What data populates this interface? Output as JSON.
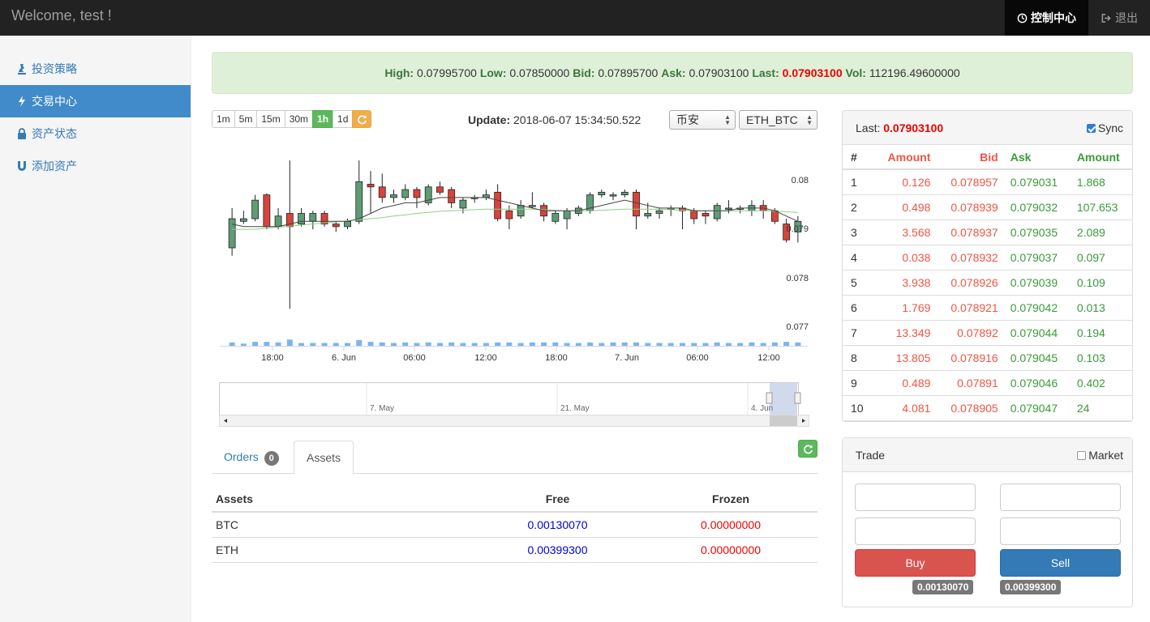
{
  "nav": {
    "brand": "Welcome, test !",
    "control_center": "控制中心",
    "logout": "退出"
  },
  "sidebar": {
    "items": [
      {
        "label": "投资策略",
        "icon": "chess-icon"
      },
      {
        "label": "交易中心",
        "icon": "flash-icon"
      },
      {
        "label": "资产状态",
        "icon": "lock-icon"
      },
      {
        "label": "添加资产",
        "icon": "magnet-icon"
      }
    ]
  },
  "ticker": {
    "high_label": "High:",
    "high": "0.07995700",
    "low_label": "Low:",
    "low": "0.07850000",
    "bid_label": "Bid:",
    "bid": "0.07895700",
    "ask_label": "Ask:",
    "ask": "0.07903100",
    "last_label": "Last:",
    "last": "0.07903100",
    "vol_label": "Vol:",
    "vol": "112196.49600000"
  },
  "intervals": [
    "1m",
    "5m",
    "15m",
    "30m",
    "1h",
    "1d"
  ],
  "active_interval": "1h",
  "update": {
    "label": "Update:",
    "value": "2018-06-07 15:34:50.522"
  },
  "exchange_select": "币安",
  "pair_select": "ETH_BTC",
  "chart_data": {
    "type": "candlestick",
    "y_ticks": [
      "0.08",
      "0.079",
      "0.078",
      "0.077"
    ],
    "ylim": [
      0.0769,
      0.0806
    ],
    "x_ticks": [
      "18:00",
      "6. Jun",
      "06:00",
      "12:00",
      "18:00",
      "7. Jun",
      "06:00",
      "12:00"
    ],
    "navigator_ticks": [
      "7. May",
      "21. May",
      "4. Jun"
    ],
    "candles": [
      [
        0.07875,
        0.0793,
        0.0795,
        0.0786
      ],
      [
        0.07925,
        0.0793,
        0.07945,
        0.0792
      ],
      [
        0.0793,
        0.07965,
        0.07975,
        0.07925
      ],
      [
        0.07975,
        0.07915,
        0.07978,
        0.0791
      ],
      [
        0.07915,
        0.07935,
        0.0795,
        0.0791
      ],
      [
        0.0794,
        0.07915,
        0.0804,
        0.0776
      ],
      [
        0.0792,
        0.0794,
        0.0795,
        0.07915
      ],
      [
        0.07925,
        0.0794,
        0.07945,
        0.0791
      ],
      [
        0.0794,
        0.0792,
        0.07945,
        0.07915
      ],
      [
        0.0792,
        0.07915,
        0.07925,
        0.07905
      ],
      [
        0.07915,
        0.07925,
        0.0793,
        0.0791
      ],
      [
        0.07925,
        0.08,
        0.0804,
        0.0792
      ],
      [
        0.07995,
        0.0799,
        0.0802,
        0.0794
      ],
      [
        0.0799,
        0.0797,
        0.08015,
        0.0796
      ],
      [
        0.0797,
        0.07975,
        0.07985,
        0.0796
      ],
      [
        0.0797,
        0.07985,
        0.07995,
        0.07965
      ],
      [
        0.07985,
        0.0797,
        0.0799,
        0.0795
      ],
      [
        0.0796,
        0.0799,
        0.07995,
        0.07955
      ],
      [
        0.0799,
        0.0798,
        0.08,
        0.07975
      ],
      [
        0.07985,
        0.0796,
        0.0799,
        0.0795
      ],
      [
        0.0795,
        0.07965,
        0.0797,
        0.0794
      ],
      [
        0.0797,
        0.0797,
        0.07975,
        0.0796
      ],
      [
        0.0797,
        0.07975,
        0.07985,
        0.07965
      ],
      [
        0.0798,
        0.0793,
        0.07995,
        0.07925
      ],
      [
        0.07945,
        0.0793,
        0.07955,
        0.0791
      ],
      [
        0.07935,
        0.07955,
        0.07965,
        0.0793
      ],
      [
        0.07955,
        0.07955,
        0.0798,
        0.0795
      ],
      [
        0.07955,
        0.07935,
        0.0796,
        0.07925
      ],
      [
        0.07925,
        0.0794,
        0.07945,
        0.0792
      ],
      [
        0.0793,
        0.07945,
        0.0795,
        0.0791
      ],
      [
        0.0794,
        0.0795,
        0.07955,
        0.07935
      ],
      [
        0.07945,
        0.07975,
        0.0798,
        0.0794
      ],
      [
        0.07975,
        0.0798,
        0.07985,
        0.0797
      ],
      [
        0.07975,
        0.07975,
        0.0798,
        0.07965
      ],
      [
        0.07975,
        0.0798,
        0.07985,
        0.0797
      ],
      [
        0.0798,
        0.07935,
        0.07985,
        0.0791
      ],
      [
        0.07935,
        0.0794,
        0.0796,
        0.0793
      ],
      [
        0.0794,
        0.07945,
        0.0795,
        0.0793
      ],
      [
        0.0795,
        0.0795,
        0.07955,
        0.07935
      ],
      [
        0.0795,
        0.07945,
        0.07955,
        0.0791
      ],
      [
        0.07945,
        0.0793,
        0.0795,
        0.0792
      ],
      [
        0.0794,
        0.07935,
        0.07945,
        0.0792
      ],
      [
        0.0793,
        0.07955,
        0.0796,
        0.07925
      ],
      [
        0.0795,
        0.0795,
        0.07965,
        0.0794
      ],
      [
        0.0795,
        0.0795,
        0.07955,
        0.0794
      ],
      [
        0.07945,
        0.07955,
        0.07965,
        0.07935
      ],
      [
        0.07955,
        0.07945,
        0.07965,
        0.0793
      ],
      [
        0.07945,
        0.07925,
        0.0795,
        0.0792
      ],
      [
        0.0792,
        0.0789,
        0.0793,
        0.07885
      ],
      [
        0.07905,
        0.07925,
        0.07935,
        0.07885
      ]
    ],
    "volumes": [
      0.3,
      0.2,
      0.35,
      0.35,
      0.3,
      0.55,
      0.25,
      0.25,
      0.25,
      0.25,
      0.25,
      0.5,
      0.35,
      0.3,
      0.25,
      0.3,
      0.25,
      0.3,
      0.25,
      0.3,
      0.25,
      0.25,
      0.25,
      0.3,
      0.3,
      0.25,
      0.3,
      0.3,
      0.3,
      0.25,
      0.25,
      0.3,
      0.25,
      0.3,
      0.3,
      0.3,
      0.25,
      0.25,
      0.25,
      0.25,
      0.25,
      0.25,
      0.3,
      0.25,
      0.25,
      0.3,
      0.25,
      0.3,
      0.35,
      0.3
    ],
    "ma_dark": [
      0.0792,
      0.07915,
      0.07915,
      0.07915,
      0.07915,
      0.0792,
      0.07925,
      0.07925,
      0.07925,
      0.07925,
      0.07925,
      0.0793,
      0.0794,
      0.0795,
      0.07955,
      0.0796,
      0.0796,
      0.07965,
      0.0797,
      0.0797,
      0.0797,
      0.0797,
      0.0797,
      0.07965,
      0.0796,
      0.07955,
      0.0795,
      0.07945,
      0.07945,
      0.07945,
      0.07945,
      0.0795,
      0.07955,
      0.0796,
      0.07965,
      0.0796,
      0.07955,
      0.0795,
      0.0795,
      0.0795,
      0.07945,
      0.07945,
      0.07945,
      0.07945,
      0.0795,
      0.0795,
      0.0795,
      0.07945,
      0.07935,
      0.07925
    ],
    "ma_light": [
      0.0791,
      0.0791,
      0.0791,
      0.07912,
      0.07914,
      0.07916,
      0.07918,
      0.0792,
      0.07922,
      0.07924,
      0.07926,
      0.07928,
      0.0793,
      0.07932,
      0.07935,
      0.07937,
      0.0794,
      0.07942,
      0.07944,
      0.07945,
      0.07946,
      0.07947,
      0.07948,
      0.07948,
      0.07948,
      0.07948,
      0.07948,
      0.07947,
      0.07946,
      0.07945,
      0.07945,
      0.07945,
      0.07946,
      0.07947,
      0.07948,
      0.07948,
      0.07948,
      0.07948,
      0.07947,
      0.07946,
      0.07945,
      0.07945,
      0.07945,
      0.07945,
      0.07945,
      0.07945,
      0.07945,
      0.07944,
      0.07943,
      0.07942
    ]
  },
  "tabs": {
    "orders": "Orders",
    "orders_count": "0",
    "assets": "Assets"
  },
  "assets_table": {
    "headers": [
      "Assets",
      "Free",
      "Frozen"
    ],
    "rows": [
      [
        "BTC",
        "0.00130070",
        "0.00000000"
      ],
      [
        "ETH",
        "0.00399300",
        "0.00000000"
      ]
    ]
  },
  "orderbook": {
    "last_label": "Last:",
    "last": "0.07903100",
    "sync": "Sync",
    "headers": [
      "#",
      "Amount",
      "Bid",
      "Ask",
      "Amount"
    ],
    "rows": [
      [
        "1",
        "0.126",
        "0.078957",
        "0.079031",
        "1.868"
      ],
      [
        "2",
        "0.498",
        "0.078939",
        "0.079032",
        "107.653"
      ],
      [
        "3",
        "3.568",
        "0.078937",
        "0.079035",
        "2.089"
      ],
      [
        "4",
        "0.038",
        "0.078932",
        "0.079037",
        "0.097"
      ],
      [
        "5",
        "3.938",
        "0.078926",
        "0.079039",
        "0.109"
      ],
      [
        "6",
        "1.769",
        "0.078921",
        "0.079042",
        "0.013"
      ],
      [
        "7",
        "13.349",
        "0.07892",
        "0.079044",
        "0.194"
      ],
      [
        "8",
        "13.805",
        "0.078916",
        "0.079045",
        "0.103"
      ],
      [
        "9",
        "0.489",
        "0.07891",
        "0.079046",
        "0.402"
      ],
      [
        "10",
        "4.081",
        "0.078905",
        "0.079047",
        "24"
      ]
    ]
  },
  "trade": {
    "title": "Trade",
    "market": "Market",
    "buy": "Buy",
    "sell": "Sell",
    "buy_balance": "0.00130070",
    "sell_balance": "0.00399300"
  },
  "colors": {
    "up": "#5e9c76",
    "down": "#d9433a",
    "volume": "#7cb5ec",
    "accent_blue": "#428bca",
    "ticker_bg": "#dff0d8"
  }
}
